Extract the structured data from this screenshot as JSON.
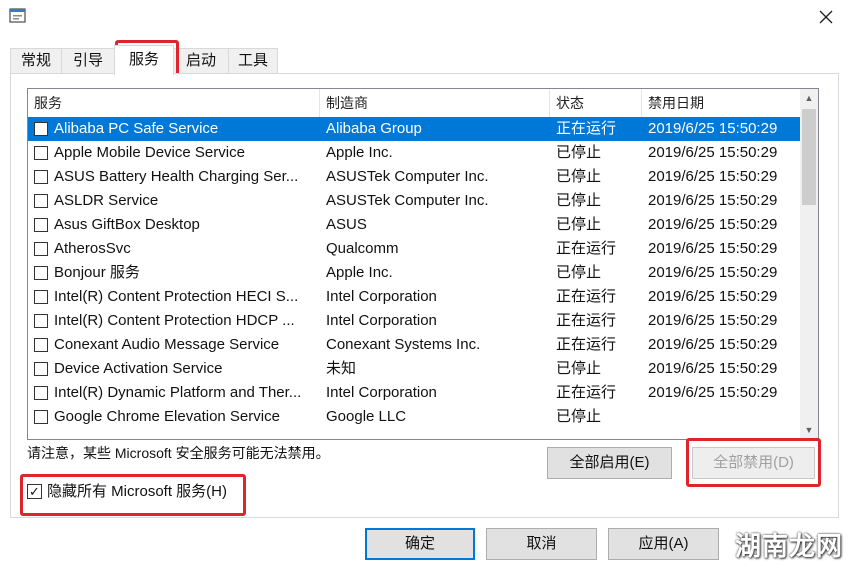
{
  "tabs": [
    {
      "label": "常规"
    },
    {
      "label": "引导"
    },
    {
      "label": "服务"
    },
    {
      "label": "启动"
    },
    {
      "label": "工具"
    }
  ],
  "active_tab": "服务",
  "list": {
    "headers": {
      "name": "服务",
      "maker": "制造商",
      "status": "状态",
      "date": "禁用日期"
    },
    "rows": [
      {
        "name": "Alibaba PC Safe Service",
        "maker": "Alibaba Group",
        "status": "正在运行",
        "date": "2019/6/25 15:50:29",
        "selected": true
      },
      {
        "name": "Apple Mobile Device Service",
        "maker": "Apple Inc.",
        "status": "已停止",
        "date": "2019/6/25 15:50:29"
      },
      {
        "name": "ASUS Battery Health Charging Ser...",
        "maker": "ASUSTek Computer Inc.",
        "status": "已停止",
        "date": "2019/6/25 15:50:29"
      },
      {
        "name": "ASLDR Service",
        "maker": "ASUSTek Computer Inc.",
        "status": "已停止",
        "date": "2019/6/25 15:50:29"
      },
      {
        "name": "Asus GiftBox Desktop",
        "maker": "ASUS",
        "status": "已停止",
        "date": "2019/6/25 15:50:29"
      },
      {
        "name": "AtherosSvc",
        "maker": "Qualcomm",
        "status": "正在运行",
        "date": "2019/6/25 15:50:29"
      },
      {
        "name": "Bonjour 服务",
        "maker": "Apple Inc.",
        "status": "已停止",
        "date": "2019/6/25 15:50:29"
      },
      {
        "name": "Intel(R) Content Protection HECI S...",
        "maker": "Intel Corporation",
        "status": "正在运行",
        "date": "2019/6/25 15:50:29"
      },
      {
        "name": "Intel(R) Content Protection HDCP ...",
        "maker": "Intel Corporation",
        "status": "正在运行",
        "date": "2019/6/25 15:50:29"
      },
      {
        "name": "Conexant Audio Message Service",
        "maker": "Conexant Systems Inc.",
        "status": "正在运行",
        "date": "2019/6/25 15:50:29"
      },
      {
        "name": "Device Activation Service",
        "maker": "未知",
        "status": "已停止",
        "date": "2019/6/25 15:50:29"
      },
      {
        "name": "Intel(R) Dynamic Platform and Ther...",
        "maker": "Intel Corporation",
        "status": "正在运行",
        "date": "2019/6/25 15:50:29"
      },
      {
        "name": "Google Chrome Elevation Service",
        "maker": "Google LLC",
        "status": "已停止",
        "date": ""
      }
    ]
  },
  "notice": "请注意，某些 Microsoft 安全服务可能无法禁用。",
  "buttons": {
    "enable_all": "全部启用(E)",
    "disable_all": "全部禁用(D)",
    "ok": "确定",
    "cancel": "取消",
    "apply": "应用(A)"
  },
  "hide_ms": {
    "label": "隐藏所有 Microsoft 服务(H)",
    "checked": true
  },
  "watermark": "湖南龙网",
  "icons": {
    "app": "msconfig-window-icon",
    "close": "close-icon"
  },
  "colors": {
    "selection": "#0078d7",
    "highlight_box": "#e0242b"
  }
}
